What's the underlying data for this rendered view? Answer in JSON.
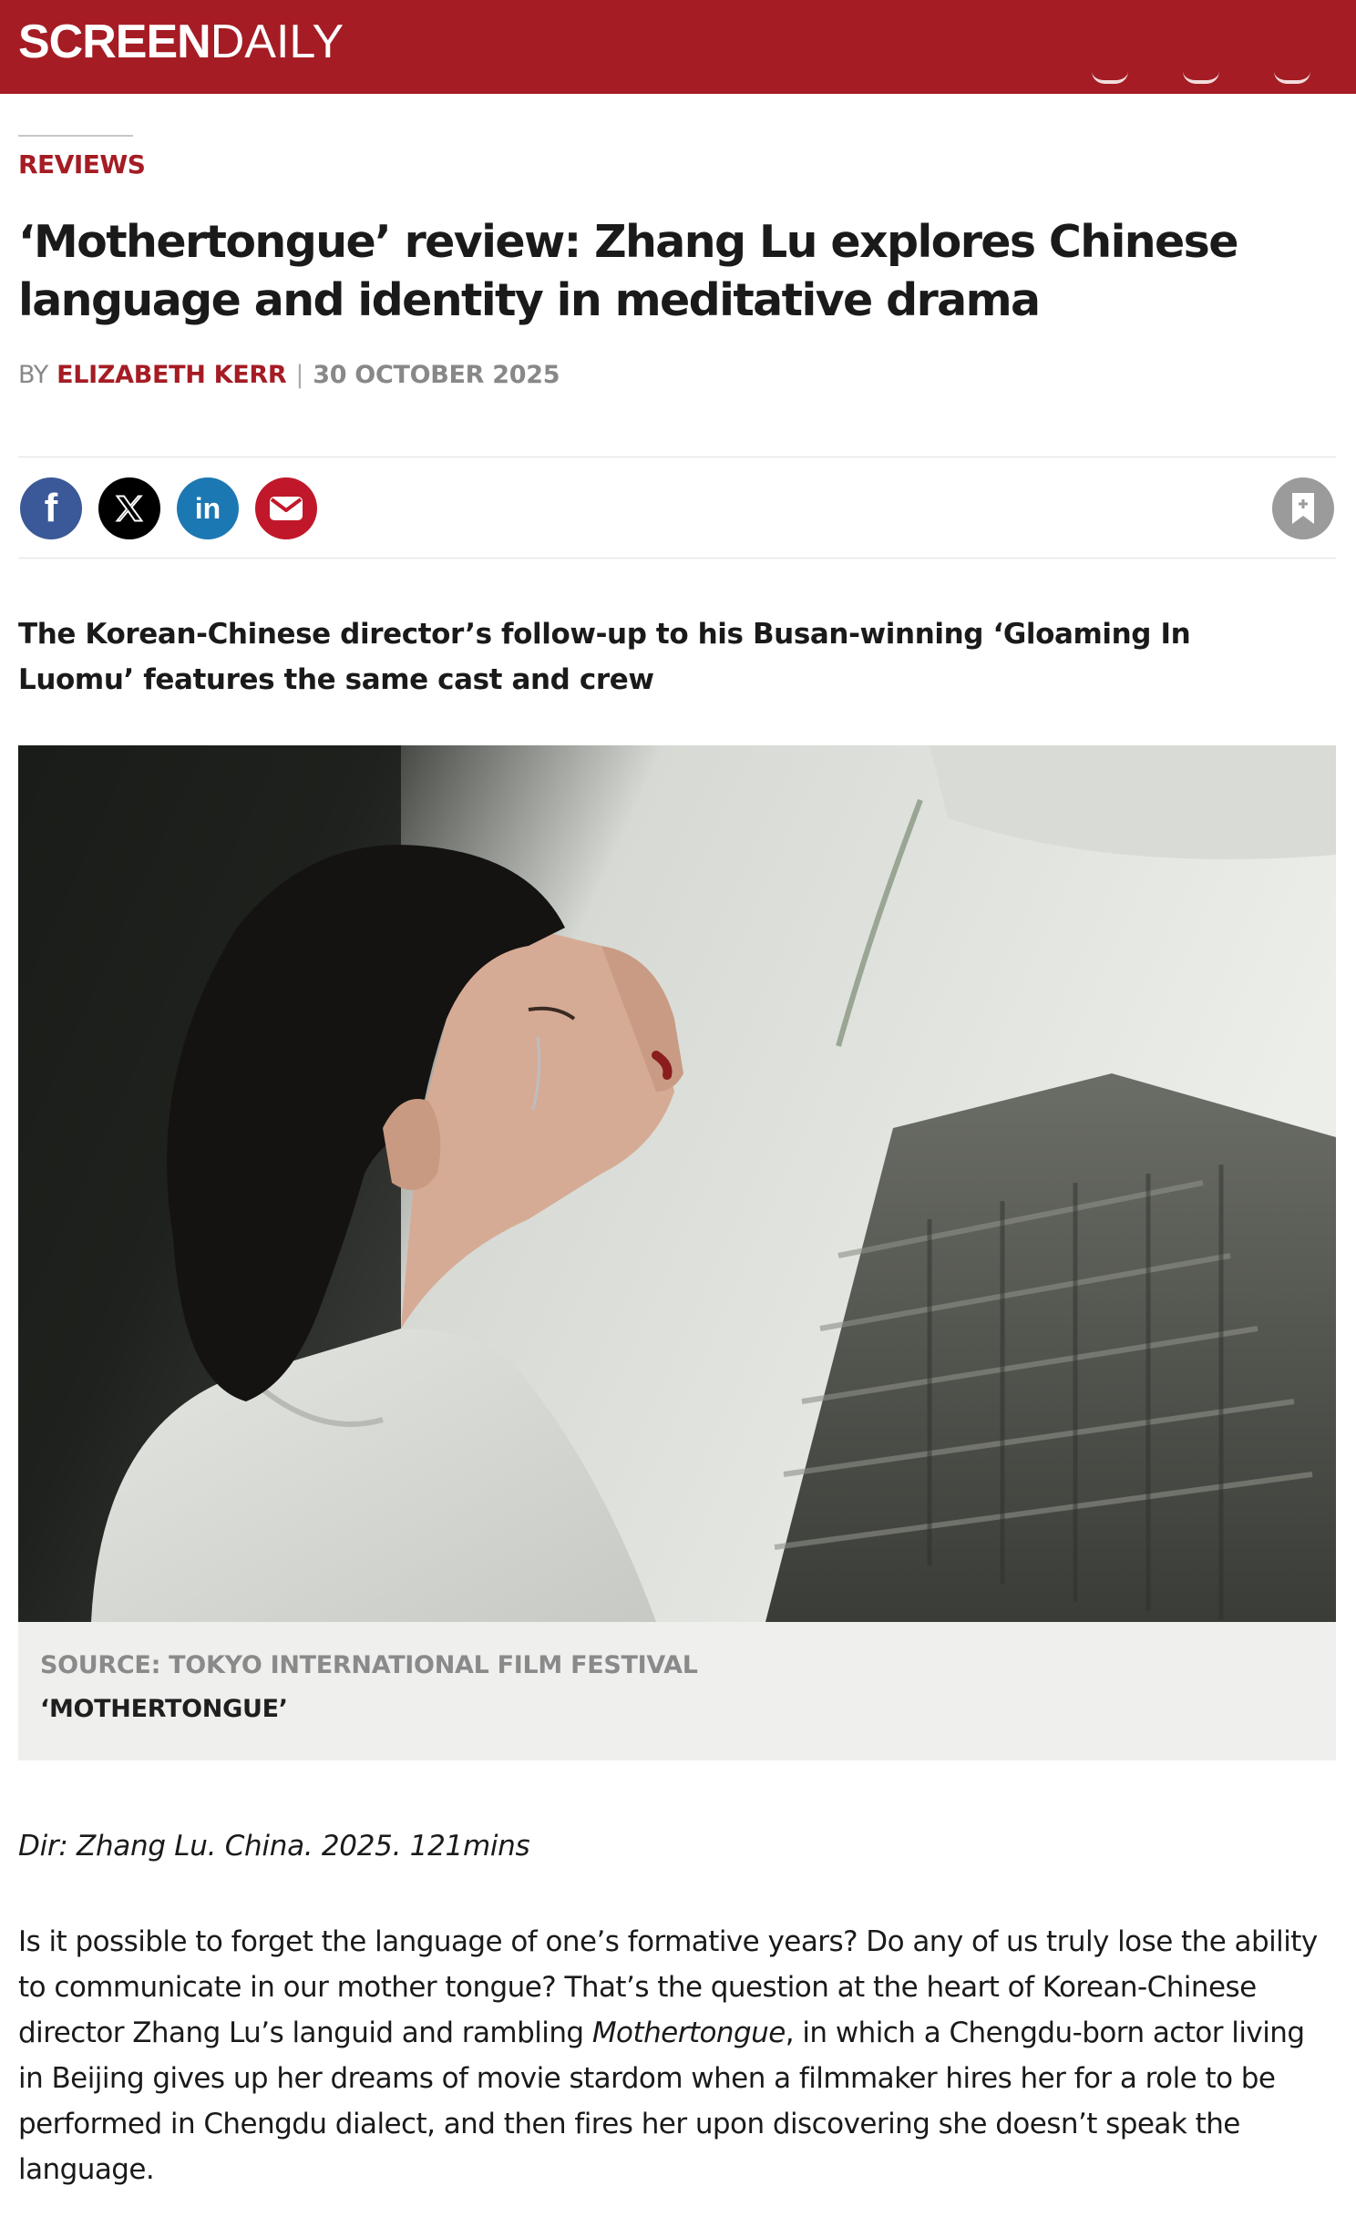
{
  "masthead": {
    "logo_bold": "SCREEN",
    "logo_light": "DAILY"
  },
  "article": {
    "category": "REVIEWS",
    "headline": "‘Mothertongue’ review: Zhang Lu explores Chinese language and identity in meditative drama",
    "byline": {
      "by": "BY",
      "author": "ELIZABETH KERR",
      "separator": "|",
      "date": "30 OCTOBER 2025"
    },
    "share": {
      "facebook": "f",
      "x": "𝕏",
      "linkedin": "in"
    },
    "standfirst": "The Korean-Chinese director’s follow-up to his Busan-winning ‘Gloaming In Luomu’ features the same cast and crew",
    "image": {
      "source": "SOURCE: TOKYO INTERNATIONAL FILM FESTIVAL",
      "caption": "‘MOTHERTONGUE’"
    },
    "credits": "Dir: Zhang Lu. China. 2025. 121mins",
    "body": {
      "p1_a": "Is it possible to forget the language of one’s formative years? Do any of us truly lose the ability to communicate in our mother tongue? That’s the question at the heart of Korean-Chinese director Zhang Lu’s languid and rambling ",
      "p1_title": "Mothertongue",
      "p1_b": ", in which a Chengdu-born actor living in Beijing gives up her dreams of movie stardom when a filmmaker hires her for a role to be performed in Chengdu dialect, and then fires her upon discovering she doesn’t speak the language."
    }
  },
  "icons": [
    "facebook-icon",
    "x-icon",
    "linkedin-icon",
    "email-icon",
    "bookmark-icon"
  ],
  "colors": {
    "brand_red": "#a51c24",
    "facebook": "#3b5998",
    "linkedin": "#1c78b2",
    "email": "#c0182a",
    "caption_bg": "#eff0ee"
  }
}
